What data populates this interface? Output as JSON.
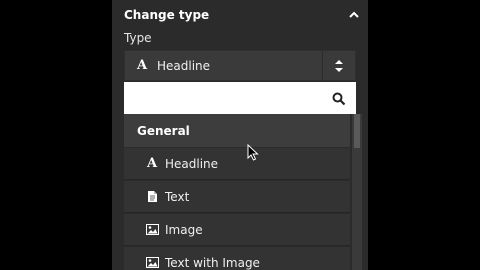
{
  "panel": {
    "title": "Change type",
    "type_label": "Type"
  },
  "select": {
    "icon": "serif-A-icon",
    "value": "Headline"
  },
  "search": {
    "placeholder": "",
    "value": ""
  },
  "list": {
    "group": "General",
    "items": [
      {
        "label": "Headline",
        "icon": "headline-icon"
      },
      {
        "label": "Text",
        "icon": "document-icon"
      },
      {
        "label": "Image",
        "icon": "image-icon"
      },
      {
        "label": "Text with Image",
        "icon": "image-icon"
      }
    ]
  },
  "colors": {
    "panel_bg": "#2b2b2b",
    "item_bg": "#333333",
    "group_bg": "#3d3d3d",
    "search_bg": "#ffffff"
  }
}
